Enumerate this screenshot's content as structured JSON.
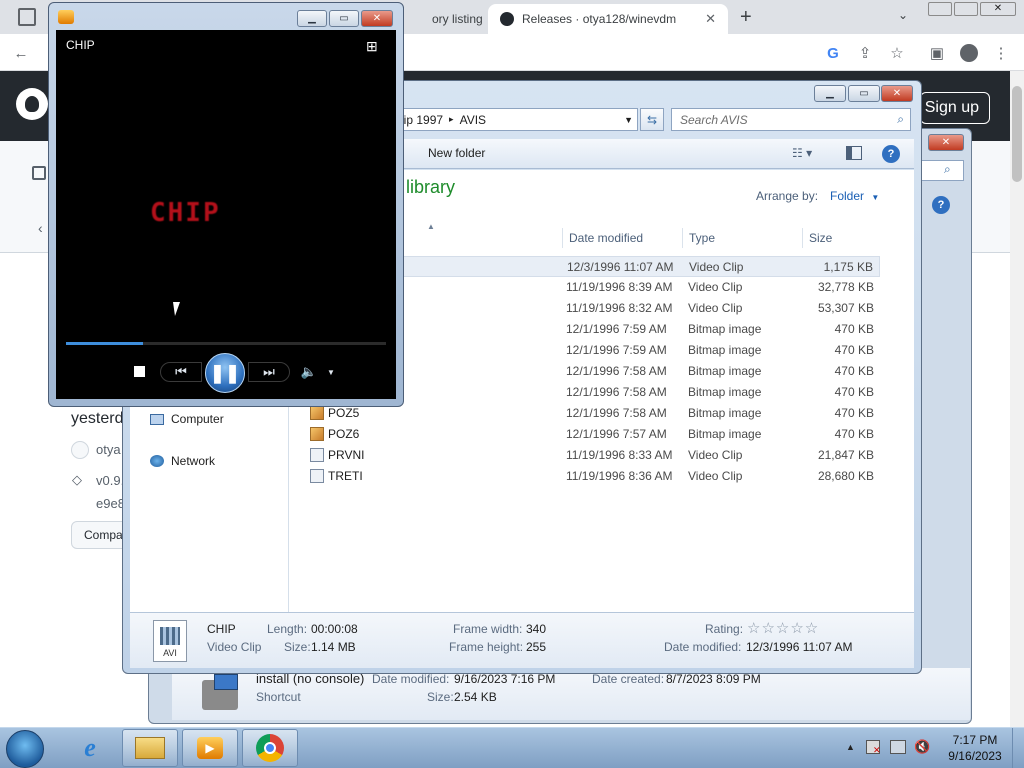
{
  "browser": {
    "tabs": [
      {
        "label": "ory listing"
      },
      {
        "label": "Releases · otya128/winevdm"
      }
    ],
    "new_tab_label": "+",
    "github": {
      "signup_label": "Sign up",
      "release_time_fragment": "yesterd",
      "author_fragment": "otya",
      "tag_fragment": "v0.9.",
      "commit_fragment": "e9e8",
      "compare_fragment": "Compa"
    }
  },
  "explorer": {
    "breadcrumb": [
      "hip 1997",
      "AVIS"
    ],
    "search_placeholder": "Search AVIS",
    "new_folder_label": "New folder",
    "library_title": "library",
    "arrange_label": "Arrange by:",
    "arrange_value": "Folder",
    "columns": [
      "Date modified",
      "Type",
      "Size"
    ],
    "nav_items": [
      {
        "label": "Computer"
      },
      {
        "label": "Network"
      }
    ],
    "files": [
      {
        "name": "",
        "date": "12/3/1996 11:07 AM",
        "type": "Video Clip",
        "size": "1,175 KB",
        "icon": "video",
        "selected": true
      },
      {
        "name": "",
        "date": "11/19/1996 8:39 AM",
        "type": "Video Clip",
        "size": "32,778 KB",
        "icon": "video"
      },
      {
        "name": "",
        "date": "11/19/1996 8:32 AM",
        "type": "Video Clip",
        "size": "53,307 KB",
        "icon": "video"
      },
      {
        "name": "",
        "date": "12/1/1996 7:59 AM",
        "type": "Bitmap image",
        "size": "470 KB",
        "icon": "bmp"
      },
      {
        "name": "",
        "date": "12/1/1996 7:59 AM",
        "type": "Bitmap image",
        "size": "470 KB",
        "icon": "bmp"
      },
      {
        "name": "",
        "date": "12/1/1996 7:58 AM",
        "type": "Bitmap image",
        "size": "470 KB",
        "icon": "bmp"
      },
      {
        "name": "",
        "date": "12/1/1996 7:58 AM",
        "type": "Bitmap image",
        "size": "470 KB",
        "icon": "bmp"
      },
      {
        "name": "POZ5",
        "date": "12/1/1996 7:58 AM",
        "type": "Bitmap image",
        "size": "470 KB",
        "icon": "bmp"
      },
      {
        "name": "POZ6",
        "date": "12/1/1996 7:57 AM",
        "type": "Bitmap image",
        "size": "470 KB",
        "icon": "bmp"
      },
      {
        "name": "PRVNI",
        "date": "11/19/1996 8:33 AM",
        "type": "Video Clip",
        "size": "21,847 KB",
        "icon": "video"
      },
      {
        "name": "TRETI",
        "date": "11/19/1996 8:36 AM",
        "type": "Video Clip",
        "size": "28,680 KB",
        "icon": "video"
      }
    ],
    "details": {
      "name": "CHIP",
      "type": "Video Clip",
      "length_label": "Length:",
      "length": "00:00:08",
      "size_label": "Size:",
      "size": "1.14 MB",
      "frame_width_label": "Frame width:",
      "frame_width": "340",
      "frame_height_label": "Frame height:",
      "frame_height": "255",
      "rating_label": "Rating:",
      "rating_stars": "☆☆☆☆☆",
      "date_label": "Date modified:",
      "date": "12/3/1996 11:07 AM",
      "icon_caption": "AVI"
    }
  },
  "explorer_behind": {
    "item_name": "install (no console)",
    "item_type": "Shortcut",
    "date_modified_label": "Date modified:",
    "date_modified": "9/16/2023 7:16 PM",
    "date_created_label": "Date created:",
    "date_created": "8/7/2023 8:09 PM",
    "size_label": "Size:",
    "size": "2.54 KB"
  },
  "player": {
    "title": "CHIP",
    "video_text": "CHIP",
    "progress": 0.24
  },
  "taskbar": {
    "time": "7:17 PM",
    "date": "9/16/2023"
  },
  "colors": {
    "library_green": "#1e8c2b",
    "arrange_blue": "#1a5fb4",
    "video_red": "#b3101a",
    "seek_blue": "#3e8edc"
  }
}
